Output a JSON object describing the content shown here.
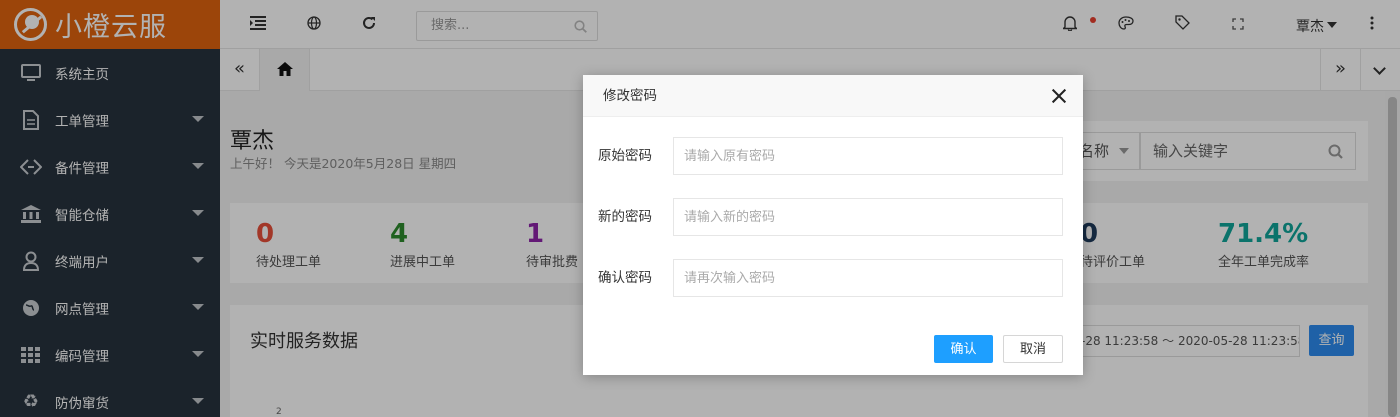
{
  "logo": {
    "text": "小橙云服",
    "color": "#e0640f"
  },
  "sidebar": {
    "items": [
      {
        "label": "系统主页",
        "icon": "monitor-icon",
        "has_submenu": false
      },
      {
        "label": "工单管理",
        "icon": "document-icon",
        "has_submenu": true
      },
      {
        "label": "备件管理",
        "icon": "diamond-link-icon",
        "has_submenu": true
      },
      {
        "label": "智能仓储",
        "icon": "bank-icon",
        "has_submenu": true
      },
      {
        "label": "终端用户",
        "icon": "user-icon",
        "has_submenu": true
      },
      {
        "label": "网点管理",
        "icon": "globe-icon",
        "has_submenu": true
      },
      {
        "label": "编码管理",
        "icon": "grid-icon",
        "has_submenu": true
      },
      {
        "label": "防伪窜货",
        "icon": "recycle-icon",
        "has_submenu": true
      }
    ]
  },
  "header": {
    "search_placeholder": "搜索...",
    "user_name": "覃杰"
  },
  "greeting": {
    "name": "覃杰",
    "subtitle": "上午好！ 今天是2020年5月28日 星期四"
  },
  "filter": {
    "select_value": "名称",
    "keyword_placeholder": "输入关键字"
  },
  "stats": [
    {
      "value": "0",
      "label": "待处理工单",
      "color": "#e8503a"
    },
    {
      "value": "4",
      "label": "进展中工单",
      "color": "#2e8b2e"
    },
    {
      "value": "1",
      "label": "待审批费",
      "color": "#8e24aa"
    },
    {
      "value": "0",
      "label": "待评价工单",
      "color": "#1f3b5c"
    },
    {
      "value": "71.4%",
      "label": "全年工单完成率",
      "color": "#10a59a"
    }
  ],
  "realtime": {
    "title": "实时服务数据",
    "date_range": "-28 11:23:58 ～ 2020-05-28 11:23:58",
    "query_label": "查询",
    "axis_tick": "2"
  },
  "dialog": {
    "title": "修改密码",
    "fields": [
      {
        "label": "原始密码",
        "placeholder": "请输入原有密码"
      },
      {
        "label": "新的密码",
        "placeholder": "请输入新的密码"
      },
      {
        "label": "确认密码",
        "placeholder": "请再次输入密码"
      }
    ],
    "confirm_label": "确认",
    "cancel_label": "取消"
  }
}
